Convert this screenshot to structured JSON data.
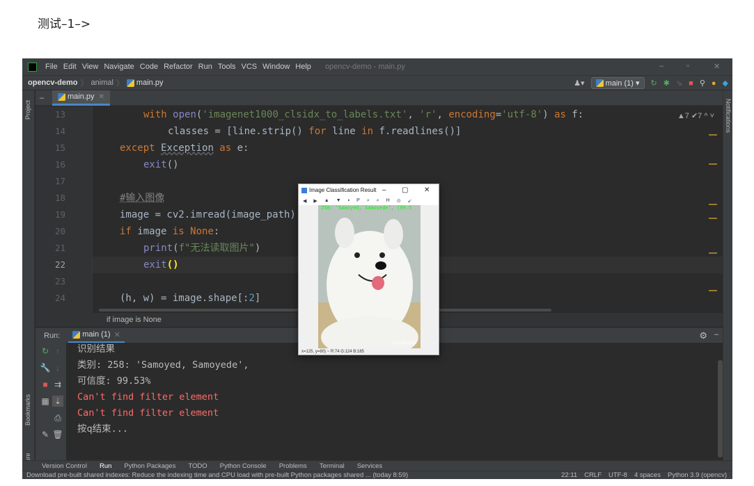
{
  "caption": "测试–1–>",
  "ide": {
    "menu": [
      "File",
      "Edit",
      "View",
      "Navigate",
      "Code",
      "Refactor",
      "Run",
      "Tools",
      "VCS",
      "Window",
      "Help"
    ],
    "window_title": "opencv-demo - main.py",
    "breadcrumb": {
      "project": "opencv-demo",
      "folder": "animal",
      "file": "main.py"
    },
    "run_config": "main (1)",
    "tab_label": "main.py",
    "left_tool_windows": [
      "Project",
      "Bookmarks",
      "Structure"
    ],
    "right_tool_windows": [
      "Notifications"
    ],
    "inspection_summary": "▲7 ✔7 ^ ˅",
    "code_lines": [
      {
        "no": "13"
      },
      {
        "no": "14"
      },
      {
        "no": "15"
      },
      {
        "no": "16"
      },
      {
        "no": "17"
      },
      {
        "no": "18"
      },
      {
        "no": "19"
      },
      {
        "no": "20"
      },
      {
        "no": "21"
      },
      {
        "no": "22"
      },
      {
        "no": "23"
      },
      {
        "no": "24"
      }
    ],
    "code": {
      "l13": [
        "with ",
        "open",
        "(",
        "'imagenet1000_clsidx_to_labels.txt'",
        ", ",
        "'r'",
        ", ",
        "encoding",
        "=",
        "'utf-8'",
        ") ",
        "as",
        " f:"
      ],
      "l14": [
        "classes = [line.strip() ",
        "for",
        " line ",
        "in",
        " f.readlines()]"
      ],
      "l15": [
        "except ",
        "Exception",
        " as",
        " e:"
      ],
      "l16": [
        "exit",
        "()"
      ],
      "l18": "#输入图像",
      "l19": "image = cv2.imread(image_path)",
      "l20": [
        "if",
        " image ",
        "is",
        " None",
        ":"
      ],
      "l21": [
        "print",
        "(",
        "f\"无法读取图片\"",
        ")"
      ],
      "l22": [
        "exit",
        "()"
      ],
      "l24": [
        "(h, w) = image.shape[:",
        "2",
        "]"
      ]
    },
    "hint": "if image is None",
    "run": {
      "label": "Run:",
      "tab": "main (1)",
      "output": [
        {
          "text": "识别结果",
          "err": false
        },
        {
          "text": "类别: 258: 'Samoyed, Samoyede',",
          "err": false
        },
        {
          "text": "可信度: 99.53%",
          "err": false
        },
        {
          "text": "Can't find filter element",
          "err": true
        },
        {
          "text": "Can't find filter element",
          "err": true
        },
        {
          "text": "按q结束...",
          "err": false
        }
      ]
    },
    "bottom_tabs": [
      "Version Control",
      "Run",
      "Python Packages",
      "TODO",
      "Python Console",
      "Problems",
      "Terminal",
      "Services"
    ],
    "status_message": "Download pre-built shared indexes: Reduce the indexing time and CPU load with pre-built Python packages shared ... (today 8:59)",
    "status_right": [
      "22:11",
      "CRLF",
      "UTF-8",
      "4 spaces",
      "Python 3.9 (opencv)"
    ]
  },
  "popup": {
    "title": "Image Classification Result",
    "label": "258: 'Samoyed, Samoyede', (99.5",
    "watermark": "©SAMUSAN",
    "status": "x=125, y=80) ~ R:74 G:124 B:185"
  }
}
